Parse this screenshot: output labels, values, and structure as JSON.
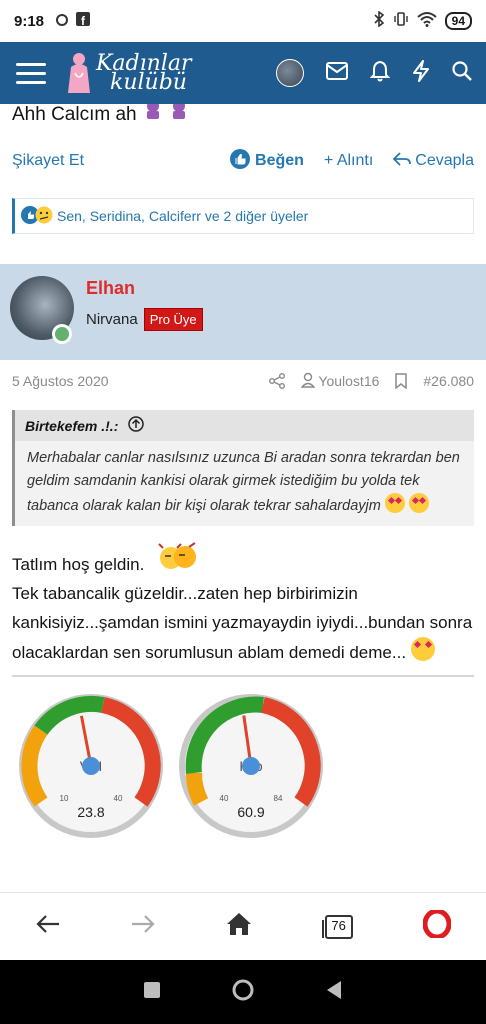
{
  "status": {
    "time": "9:18",
    "battery": "94"
  },
  "appbar": {
    "logo_line1": "Kadınlar",
    "logo_line2": "kulübü"
  },
  "prev_post": {
    "text": "Ahh Calcım ah"
  },
  "actions": {
    "report": "Şikayet Et",
    "like": "Beğen",
    "quote": "+ Alıntı",
    "reply": "Cevapla"
  },
  "reactions": {
    "text": "Sen, Seridina, Calciferr ve 2 diğer üyeler"
  },
  "post": {
    "username": "Elhan",
    "user_title": "Nirvana",
    "badge": "Pro Üye",
    "date": "5 Ağustos 2020",
    "mention": "Youlost16",
    "number": "#26.080",
    "quote_author": "Birtekefem .!.:",
    "quote_text": "Merhabalar canlar nasılsınız uzunca Bi aradan sonra tekrardan ben geldim samdanin kankisi olarak girmek istediğim bu yolda tek tabanca olarak kalan bir kişi olarak tekrar sahalardayjm",
    "msg_line1": "Tatlım hoş geldin.",
    "msg_line2": "Tek tabancalik güzeldir...zaten hep birbirimizin kankisiyiz...şamdan ismini yazmayaydin iyiydi...bundan sonra olacaklardan sen sorumlusun ablam demedi deme..."
  },
  "gauges": [
    {
      "label": "VKI",
      "min": "10",
      "max": "40",
      "value": "23.8",
      "fraction": 0.46
    },
    {
      "label": "Kilo",
      "min": "40",
      "max": "84",
      "value": "60.9",
      "fraction": 0.47
    }
  ],
  "navbar": {
    "tabs_count": "76"
  },
  "colors": {
    "brand": "#1f5b8f",
    "link": "#2577b1",
    "username": "#e02b2b",
    "badge": "#d21717"
  }
}
